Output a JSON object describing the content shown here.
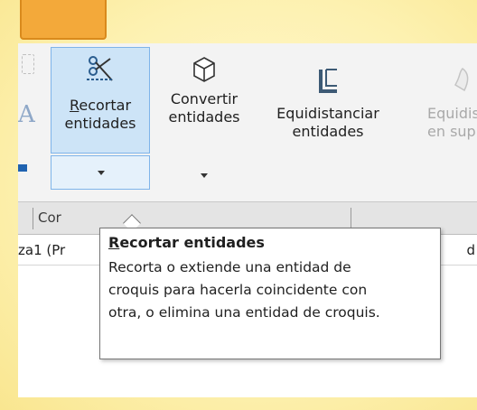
{
  "ribbon": {
    "recortar": {
      "mnemonic": "R",
      "label_line1_rest": "ecortar",
      "label_line2": "entidades",
      "icon": "trim-entities-icon"
    },
    "convertir": {
      "label_line1": "Convertir",
      "label_line2": "entidades",
      "icon": "convert-entities-cube-icon"
    },
    "equidistanciar": {
      "label_line1": "Equidistanciar",
      "label_line2": "entidades",
      "icon": "offset-entities-icon"
    },
    "equidistanciar_superficie": {
      "label_line1": "Equidist",
      "label_line2": "en sup",
      "icon": "offset-on-surface-icon",
      "state": "disabled"
    }
  },
  "command_tabs": {
    "tab1_partial": "Cor",
    "tab2_partial": "",
    "tab3_partial": ""
  },
  "document_row": {
    "left_text": "za1  (Pr",
    "right_text": "d"
  },
  "tooltip": {
    "title_mnemonic": "R",
    "title_rest": "ecortar entidades",
    "line1": "Recorta o extiende una entidad de",
    "line2": "croquis para hacerla coincidente con",
    "line3": "otra, o elimina una entidad de croquis."
  },
  "colors": {
    "slide_background": "#fdf3b8",
    "arrow_fill": "#f3a93a",
    "selected_button_fill": "#cde4f7",
    "selected_button_border": "#7eb4ea",
    "offset_icon": "#3d5a75"
  }
}
